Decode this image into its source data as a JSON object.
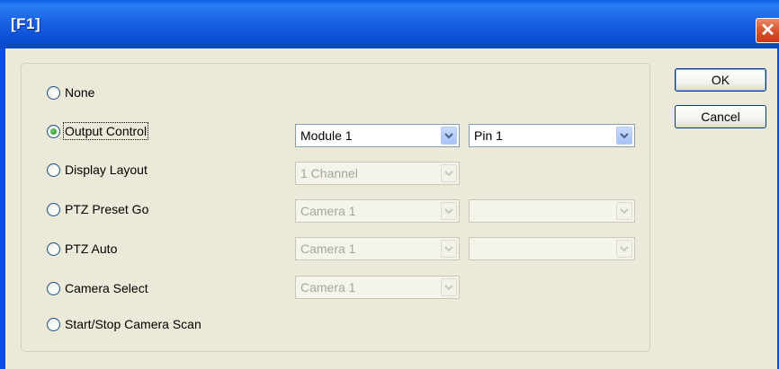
{
  "window": {
    "title": "[F1]",
    "close_symbol": "✕"
  },
  "options": [
    {
      "label": "None",
      "selected": false
    },
    {
      "label": "Output Control",
      "selected": true
    },
    {
      "label": "Display Layout",
      "selected": false
    },
    {
      "label": "PTZ Preset Go",
      "selected": false
    },
    {
      "label": "PTZ Auto",
      "selected": false
    },
    {
      "label": "Camera Select",
      "selected": false
    },
    {
      "label": "Start/Stop Camera Scan",
      "selected": false
    }
  ],
  "combos": {
    "output_module": {
      "value": "Module 1",
      "enabled": true
    },
    "output_pin": {
      "value": "Pin 1",
      "enabled": true
    },
    "display_layout": {
      "value": "1 Channel",
      "enabled": false
    },
    "ptz_preset_camera": {
      "value": "Camera 1",
      "enabled": false
    },
    "ptz_preset_preset": {
      "value": "",
      "enabled": false
    },
    "ptz_auto_camera": {
      "value": "Camera 1",
      "enabled": false
    },
    "ptz_auto_pattern": {
      "value": "",
      "enabled": false
    },
    "camera_select_camera": {
      "value": "Camera 1",
      "enabled": false
    }
  },
  "buttons": {
    "ok_label": "OK",
    "cancel_label": "Cancel"
  },
  "icons": {
    "dropdown": "chevron-down-icon",
    "close": "close-icon"
  }
}
